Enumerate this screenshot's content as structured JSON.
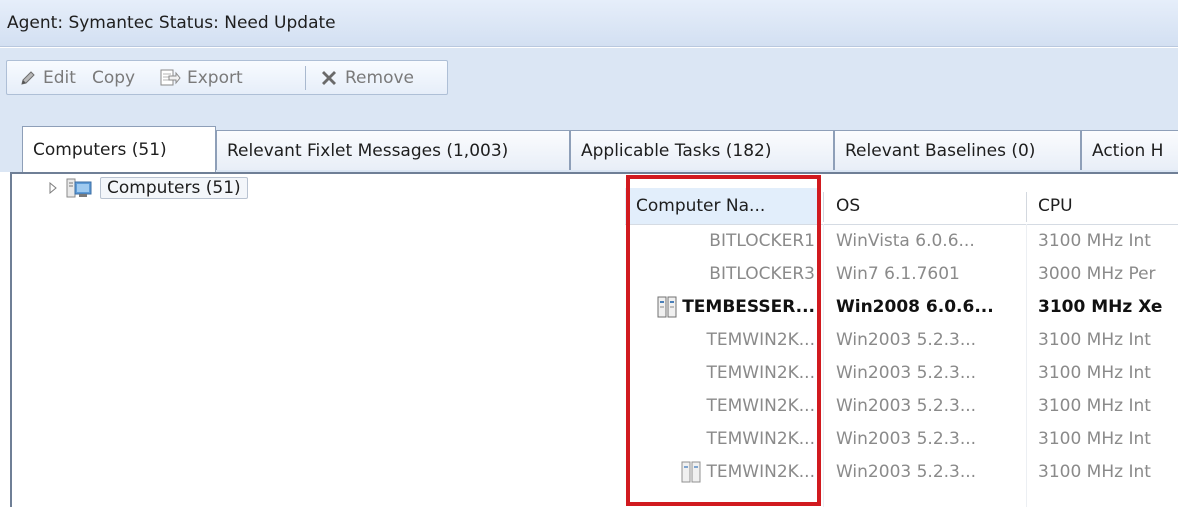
{
  "titlebar": {
    "text": "Agent: Symantec  Status: Need Update"
  },
  "toolbar": {
    "edit": {
      "label": "Edit",
      "icon": "pencil-icon"
    },
    "copy": {
      "label": "Copy"
    },
    "export": {
      "label": "Export",
      "icon": "export-icon"
    },
    "remove": {
      "label": "Remove",
      "icon": "remove-x-icon"
    }
  },
  "tabs": [
    {
      "label": "Computers (51)"
    },
    {
      "label": "Relevant Fixlet Messages (1,003)"
    },
    {
      "label": "Applicable Tasks (182)"
    },
    {
      "label": "Relevant Baselines (0)"
    },
    {
      "label": "Action H"
    }
  ],
  "tree": {
    "label": "Computers (51)",
    "icon": "computers-group-icon",
    "expander": "expand-arrow-icon"
  },
  "grid": {
    "columns": [
      {
        "label": "Computer Na..."
      },
      {
        "label": "OS"
      },
      {
        "label": "CPU"
      }
    ],
    "rows": [
      {
        "name": "BITLOCKER1",
        "os": "WinVista 6.0.6...",
        "cpu": "3100 MHz Int"
      },
      {
        "name": "BITLOCKER3",
        "os": "Win7 6.1.7601",
        "cpu": "3000 MHz Per"
      },
      {
        "name": "TEMBESSER...",
        "os": "Win2008 6.0.6...",
        "cpu": "3100 MHz Xe",
        "bold": true,
        "icon": "server-icon"
      },
      {
        "name": "TEMWIN2K...",
        "os": "Win2003 5.2.3...",
        "cpu": "3100 MHz Int"
      },
      {
        "name": "TEMWIN2K...",
        "os": "Win2003 5.2.3...",
        "cpu": "3100 MHz Int"
      },
      {
        "name": "TEMWIN2K...",
        "os": "Win2003 5.2.3...",
        "cpu": "3100 MHz Int"
      },
      {
        "name": "TEMWIN2K...",
        "os": "Win2003 5.2.3...",
        "cpu": "3100 MHz Int"
      },
      {
        "name": "TEMWIN2K...",
        "os": "Win2003 5.2.3...",
        "cpu": "3100 MHz Int",
        "icon": "server-icon"
      }
    ]
  },
  "colors": {
    "highlight": "#d11a1f",
    "toolbar_bg": "#dbe6f4",
    "sorted_header": "#e2eefb"
  }
}
